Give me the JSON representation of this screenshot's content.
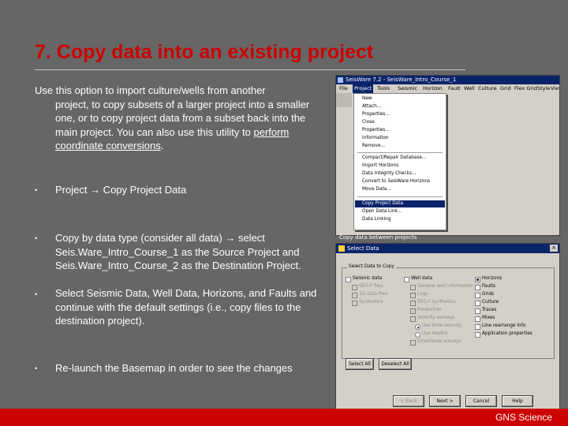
{
  "slide": {
    "title": "7. Copy data into an existing project",
    "intro_first": "Use this option to import culture/wells from another",
    "intro_rest": "project, to copy subsets of a larger project into a smaller one, or to copy project data from a subset back into the main project.  You can also use this utility to",
    "intro_link": "perform coordinate conversions",
    "intro_end": ".",
    "bullet_char": "•",
    "bullets": [
      "Project → Copy Project Data",
      "Copy by data type (consider all data) → select Seis.Ware_Intro_Course_1 as the Source Project and Seis.Ware_Intro_Course_2 as the Destination Project.",
      "Select Seismic Data, Well Data, Horizons, and Faults and continue with the default settings (i.e., copy files to the destination project).",
      "Re-launch the Basemap in order to see the changes"
    ],
    "footer": "GNS Science"
  },
  "screenshot_menu": {
    "window_title": "SeisWare 7.2 - SeisWare_Intro_Course_1",
    "menubar": [
      "File",
      "Project",
      "Tools",
      "Seismic",
      "Horizon",
      "Fault",
      "Well",
      "Culture",
      "Grid",
      "Flex Grid",
      "Style",
      "View"
    ],
    "menu_items": [
      "New",
      "Attach...",
      "Properties...",
      "Close",
      "Properties...",
      "Information",
      "Remove...",
      "Compact/Repair Database...",
      "Import Horizons",
      "Data Integrity Checks...",
      "Convert to SeisWare Horizons",
      "Move Data...",
      "Copy Project Data",
      "Open Data Link...",
      "Data Linking"
    ],
    "caption": "Copy data between projects"
  },
  "screenshot_dialog": {
    "title": "Select Data",
    "close_glyph": "×",
    "group_label": "Select Data to Copy",
    "col1": [
      {
        "label": "Seismic data",
        "on": false,
        "dis": false
      },
      {
        "label": "SEG-Y files",
        "on": false,
        "dis": true
      },
      {
        "label": "3D data files",
        "on": false,
        "dis": true
      },
      {
        "label": "Synthetics",
        "on": false,
        "dis": true
      }
    ],
    "col2": [
      {
        "label": "Well data",
        "on": false,
        "dis": false
      },
      {
        "label": "General well information",
        "on": false,
        "dis": true
      },
      {
        "label": "Logs",
        "on": false,
        "dis": true
      },
      {
        "label": "SEG-Y synthetics",
        "on": false,
        "dis": true
      },
      {
        "label": "Production",
        "on": false,
        "dis": true
      },
      {
        "label": "Velocity surveys",
        "on": false,
        "dis": true
      },
      {
        "label": "Use time-velocity",
        "on": true,
        "dis": true,
        "radio": true
      },
      {
        "label": "Use depths",
        "on": false,
        "dis": true,
        "radio": true
      },
      {
        "label": "Directional surveys",
        "on": false,
        "dis": true
      }
    ],
    "col3": [
      {
        "label": "Horizons",
        "on": true,
        "dis": false
      },
      {
        "label": "Faults",
        "on": false,
        "dis": false
      },
      {
        "label": "Grids",
        "on": false,
        "dis": false
      },
      {
        "label": "Culture",
        "on": false,
        "dis": false
      },
      {
        "label": "Traces",
        "on": false,
        "dis": false
      },
      {
        "label": "Mixes",
        "on": false,
        "dis": false
      },
      {
        "label": "Line rearrange info",
        "on": false,
        "dis": false
      },
      {
        "label": "Application properties",
        "on": false,
        "dis": false
      }
    ],
    "buttons": {
      "select_all": "Select All",
      "deselect_all": "Deselect All",
      "back": "< Back",
      "next": "Next >",
      "cancel": "Cancel",
      "help": "Help"
    }
  }
}
